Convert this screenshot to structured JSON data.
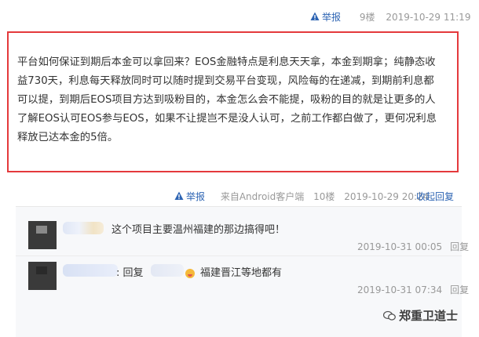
{
  "post": {
    "report_label": "举报",
    "floor": "9楼",
    "timestamp": "2019-10-29 11:19",
    "lines": [
      "平台如何保证到期后本金可以拿回来？EOS金融特点是利息天天拿，本金到期拿；纯静态收",
      "益730天，利息每天释放同时可以随时提到交易平台变现，风险每的在递减，到期前利息都",
      "可以提，到期后EOS项目方达到吸粉目的，本金怎么会不能提，吸粉的目的就是让更多的人",
      "了解EOS认可EOS参与EOS，如果不让提岂不是没人认可，之前工作都白做了，更何况利息",
      "释放已达本金的5倍。"
    ]
  },
  "reply_bar": {
    "report_label": "举报",
    "source": "来自Android客户端",
    "floor": "10楼",
    "timestamp": "2019-10-29 20:24",
    "collapse_label": "收起回复"
  },
  "sub_replies": [
    {
      "text": "这个项目主要温州福建的那边搞得吧！",
      "timestamp": "2019-10-31 00:05",
      "reply_label": "回复"
    },
    {
      "prefix": ": 回复",
      "text": "福建晋江等地都有",
      "timestamp": "2019-10-31 07:34",
      "reply_label": "回复"
    }
  ],
  "watermark": "郑重卫道士"
}
